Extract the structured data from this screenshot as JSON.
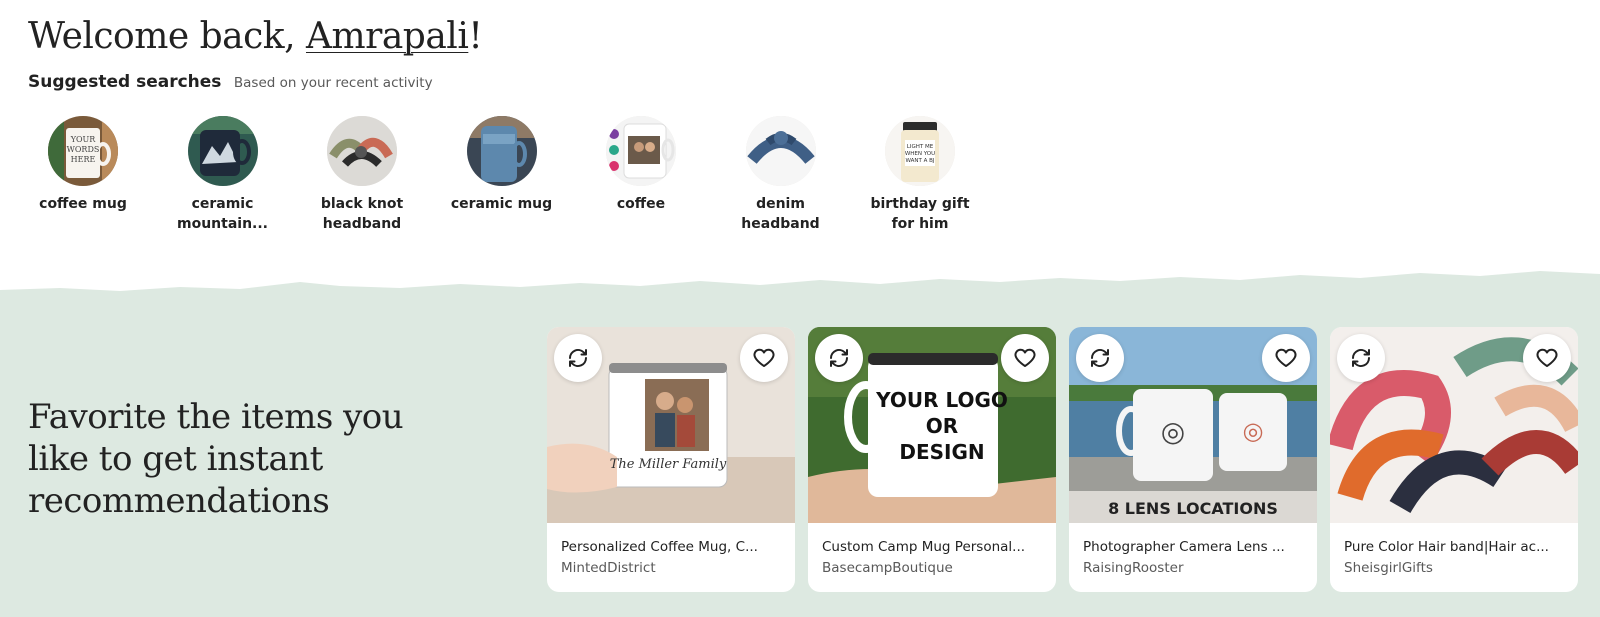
{
  "welcome": {
    "prefix": "Welcome back, ",
    "name": "Amrapali",
    "suffix": "!"
  },
  "suggested": {
    "title": "Suggested searches",
    "subtitle": "Based on your recent activity",
    "items": [
      {
        "label": "coffee mug",
        "icon": "coffee-mug-thumbnail"
      },
      {
        "label": "ceramic mountain...",
        "icon": "ceramic-mountain-mug-thumbnail"
      },
      {
        "label": "black knot headband",
        "icon": "knot-headband-thumbnail"
      },
      {
        "label": "ceramic mug",
        "icon": "blue-ceramic-mug-thumbnail"
      },
      {
        "label": "coffee",
        "icon": "photo-mug-thumbnail"
      },
      {
        "label": "denim headband",
        "icon": "denim-headband-thumbnail"
      },
      {
        "label": "birthday gift for him",
        "icon": "candle-jar-thumbnail"
      }
    ]
  },
  "favorites": {
    "message": "Favorite the items you like to get instant recommendations",
    "cards": [
      {
        "title": "Personalized Coffee Mug, C...",
        "shop": "MintedDistrict",
        "image_text": "The Miller Family"
      },
      {
        "title": "Custom Camp Mug Personal...",
        "shop": "BasecampBoutique",
        "image_text": "YOUR LOGO OR DESIGN"
      },
      {
        "title": "Photographer Camera Lens ...",
        "shop": "RaisingRooster",
        "image_text": "8 LENS LOCATIONS"
      },
      {
        "title": "Pure Color Hair band|Hair ac...",
        "shop": "SheisgirlGifts",
        "image_text": ""
      }
    ]
  },
  "colors": {
    "background": "#ffffff",
    "band": "#dde9e1",
    "text": "#222222",
    "muted": "#595959"
  },
  "icons": {
    "refresh": "refresh-icon",
    "favorite": "heart-icon"
  }
}
